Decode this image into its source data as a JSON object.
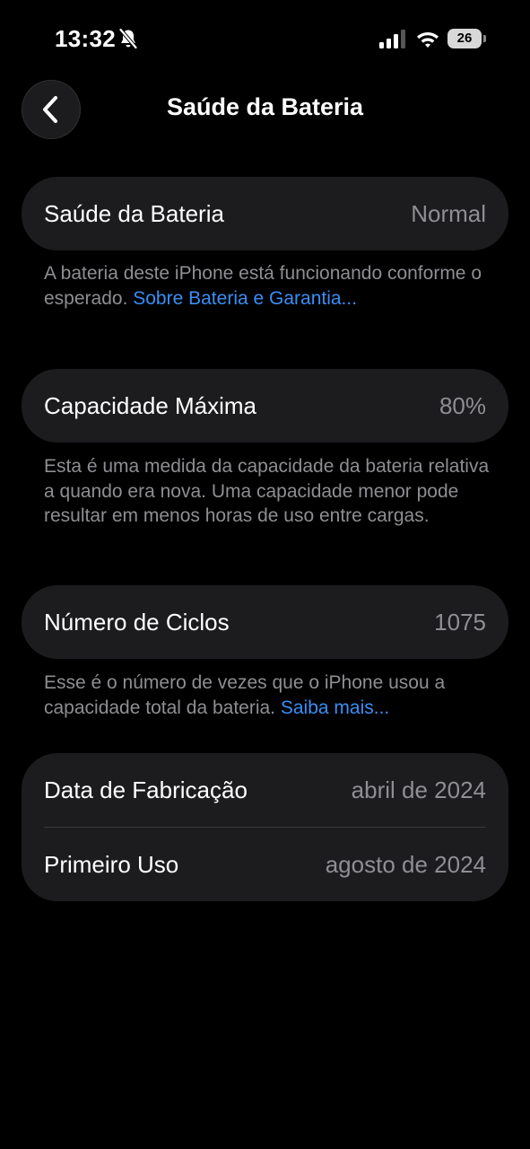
{
  "status_bar": {
    "time": "13:32",
    "battery_level": "26",
    "icons": [
      "bell-slash-icon",
      "cellular-signal-icon",
      "wifi-icon",
      "battery-icon"
    ]
  },
  "nav": {
    "title": "Saúde da Bateria",
    "back_icon": "chevron-left-icon"
  },
  "battery_health": {
    "label": "Saúde da Bateria",
    "value": "Normal",
    "note": "A bateria deste iPhone está funcionando conforme o esperado. ",
    "link": "Sobre Bateria e Garantia..."
  },
  "max_capacity": {
    "label": "Capacidade Máxima",
    "value": "80%",
    "note": "Esta é uma medida da capacidade da bateria relativa a quando era nova. Uma capacidade menor pode resultar em menos horas de uso entre cargas."
  },
  "cycle_count": {
    "label": "Número de Ciclos",
    "value": "1075",
    "note": "Esse é o número de vezes que o iPhone usou a capacidade total da bateria. ",
    "link": "Saiba mais..."
  },
  "dates": {
    "manufacture_label": "Data de Fabricação",
    "manufacture_value": "abril de 2024",
    "first_use_label": "Primeiro Uso",
    "first_use_value": "agosto de 2024"
  },
  "colors": {
    "background": "#000000",
    "card": "#1c1c1e",
    "secondary_text": "#8e8e93",
    "link": "#3a8ef6"
  }
}
